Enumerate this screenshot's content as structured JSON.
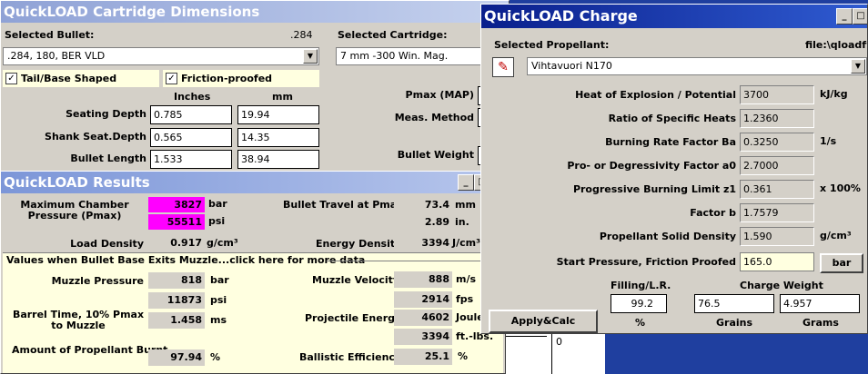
{
  "dims": {
    "title": "QuickLOAD Cartridge Dimensions",
    "selected_bullet_label": "Selected Bullet:",
    "bullet_caliber": ".284",
    "bullet_value": ".284, 180, BER VLD",
    "selected_cartridge_label": "Selected Cartridge:",
    "cartridge_value": "7 mm -300 Win. Mag.",
    "tail_base_label": "Tail/Base Shaped",
    "friction_label": "Friction-proofed",
    "col_inches": "Inches",
    "col_mm": "mm",
    "seating_depth_label": "Seating Depth",
    "seating_depth_in": "0.785",
    "seating_depth_mm": "19.94",
    "shank_label": "Shank Seat.Depth",
    "shank_in": "0.565",
    "shank_mm": "14.35",
    "bullet_length_label": "Bullet Length",
    "bullet_length_in": "1.533",
    "bullet_length_mm": "38.94",
    "pmax_label": "Pmax (MAP)",
    "meas_label": "Meas. Method",
    "bullet_weight_label": "Bullet Weight"
  },
  "results": {
    "title": "QuickLOAD Results",
    "max_pressure_label": "Maximum Chamber Pressure (Pmax)",
    "pmax_bar": "3827",
    "unit_bar": "bar",
    "pmax_psi": "55511",
    "unit_psi": "psi",
    "travel_label": "Bullet Travel at Pmax",
    "travel_mm": "73.4",
    "unit_mm": "mm",
    "travel_in": "2.89",
    "unit_in": "in.",
    "load_density_label": "Load Density",
    "load_density": "0.917",
    "unit_gcm3": "g/cm³",
    "energy_density_label": "Energy Density",
    "energy_density": "3394",
    "unit_jcm3": "J/cm³",
    "muzzle_header": "Values when Bullet Base Exits Muzzle...click here for more data",
    "muzzle_pressure_label": "Muzzle Pressure",
    "muzzle_bar": "818",
    "muzzle_psi": "11873",
    "muzzle_velocity_label": "Muzzle Velocity",
    "velocity_ms": "888",
    "unit_ms": "m/s",
    "velocity_fps": "2914",
    "unit_fps": "fps",
    "barrel_time_label": "Barrel Time, 10% Pmax to Muzzle",
    "barrel_time": "1.458",
    "unit_msec": "ms",
    "proj_energy_label": "Projectile Energy",
    "energy_joule": "4602",
    "unit_joule": "Joule",
    "energy_ftlbs": "3394",
    "unit_ftlbs": "ft.-lbs.",
    "burnt_label": "Amount of Propellant Burnt",
    "burnt": "97.94",
    "unit_pct": "%",
    "ballistic_label": "Ballistic Efficiency",
    "ballistic": "25.1",
    "unit_pct2": "%"
  },
  "charge": {
    "title": "QuickLOAD Charge",
    "selected_propellant_label": "Selected Propellant:",
    "file_label": "file:\\qloadfw",
    "propellant_value": "Vihtavuori N170",
    "heat_label": "Heat of Explosion / Potential",
    "heat_value": "3700",
    "heat_unit": "kJ/kg",
    "ratio_label": "Ratio of Specific Heats",
    "ratio_value": "1.2360",
    "burning_label": "Burning Rate Factor  Ba",
    "burning_value": "0.3250",
    "burning_unit": "1/s",
    "progdeg_label": "Pro- or Degressivity Factor  a0",
    "progdeg_value": "2.7000",
    "limit_label": "Progressive Burning Limit z1",
    "limit_value": "0.361",
    "limit_unit": "x 100%",
    "factorb_label": "Factor  b",
    "factorb_value": "1.7579",
    "density_label": "Propellant Solid Density",
    "density_value": "1.590",
    "density_unit": "g/cm³",
    "start_label": "Start Pressure, Friction Proofed",
    "start_value": "165.0",
    "bar_button": "bar",
    "filling_label": "Filling/L.R.",
    "charge_weight_label": "Charge Weight",
    "filling_value": "99.2",
    "grains_value": "76.5",
    "grams_value": "4.957",
    "pct_label": "%",
    "grains_label": "Grains",
    "grams_label": "Grams",
    "apply_button": "Apply&Calc"
  },
  "background_window": {
    "value": "0"
  }
}
